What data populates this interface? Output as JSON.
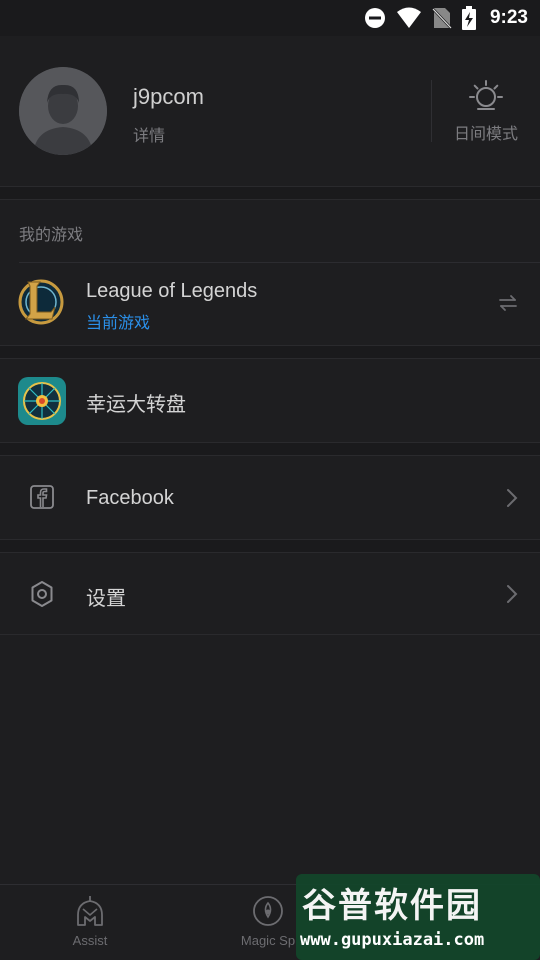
{
  "status": {
    "time": "9:23"
  },
  "profile": {
    "username": "j9pcom",
    "details_label": "详情",
    "day_mode_label": "日间模式"
  },
  "my_games": {
    "section_title": "我的游戏",
    "games": [
      {
        "name": "League of Legends",
        "subtitle": "当前游戏"
      },
      {
        "name": "幸运大转盘"
      }
    ]
  },
  "menu": {
    "facebook_label": "Facebook",
    "settings_label": "设置"
  },
  "bottom_nav": {
    "items": [
      {
        "label": "Assist"
      },
      {
        "label": "Magic Sp"
      }
    ]
  },
  "watermark": {
    "title": "谷普软件园",
    "url": "www.gupuxiazai.com"
  },
  "colors": {
    "accent_blue": "#2b8fe8",
    "background": "#1e1e20"
  }
}
